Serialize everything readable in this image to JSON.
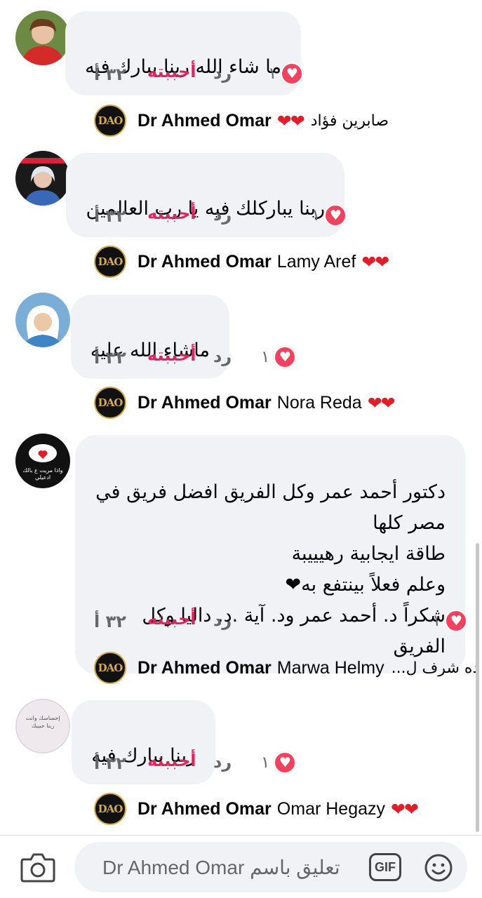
{
  "comments": [
    {
      "text": "ما شاء الله ربنا يبارك فيه",
      "reaction_count": "١",
      "reply_label": "رد",
      "like_label": "أحببته",
      "time": "٣٢ أ",
      "reply": {
        "author": "Dr Ahmed Omar",
        "mention": "",
        "hearts": "❤❤",
        "rtl_text": "صابرين فؤاد"
      }
    },
    {
      "text": "ربنا يباركلك فيه يا رب العالمين",
      "reaction_count": "١",
      "reply_label": "رد",
      "like_label": "أحببته",
      "time": "٣٢ أ",
      "reply": {
        "author": "Dr Ahmed Omar",
        "mention": "Lamy Aref",
        "hearts": "❤❤",
        "rtl_text": ""
      }
    },
    {
      "text": "ماشاء الله عليه",
      "reaction_count": "١",
      "reply_label": "رد",
      "like_label": "أحببته",
      "time": "٣٢ أ",
      "reply": {
        "author": "Dr Ahmed Omar",
        "mention": "Nora Reda",
        "hearts": "❤❤",
        "rtl_text": ""
      }
    },
    {
      "text": "دكتور أحمد عمر وكل الفريق افضل فريق في\nمصر كلها\nطاقة ايجابية رهيييبة\nوعلم فعلاً بينتفع به❤\nشكراً د. أحمد عمر ود. آية .د. داليا وكل الفريق",
      "reaction_count": "١",
      "reply_label": "رد",
      "like_label": "أحببته",
      "time": "٣٢ أ",
      "reply": {
        "author": "Dr Ahmed Omar",
        "mention": "Marwa Helmy",
        "hearts": "",
        "rtl_text": "ده شرف ل..."
      }
    },
    {
      "text": "ربنا يبارك فيه",
      "reaction_count": "١",
      "reply_label": "رد",
      "like_label": "أحببته",
      "time": "٣٢ أ",
      "reply": {
        "author": "Dr Ahmed Omar",
        "mention": "Omar Hegazy",
        "hearts": "❤❤",
        "rtl_text": ""
      }
    }
  ],
  "avatar_texts": {
    "avatar4": "واذا مريت ع بالك ادعيلي",
    "avatar5": "إحساسك وانت ربنا حبيبك"
  },
  "logo_text": "DAO",
  "composer": {
    "placeholder": "Dr Ahmed Omar تعليق باسم",
    "gif_label": "GIF"
  },
  "colors": {
    "bubble": "#f0f2f5",
    "like": "#e0245e",
    "heart_badge": "#f3425f",
    "muted": "#65676b",
    "logo_gold": "#d4aa4a"
  },
  "icons": [
    "camera-icon",
    "gif-icon",
    "emoji-icon",
    "heart-reaction-icon"
  ]
}
